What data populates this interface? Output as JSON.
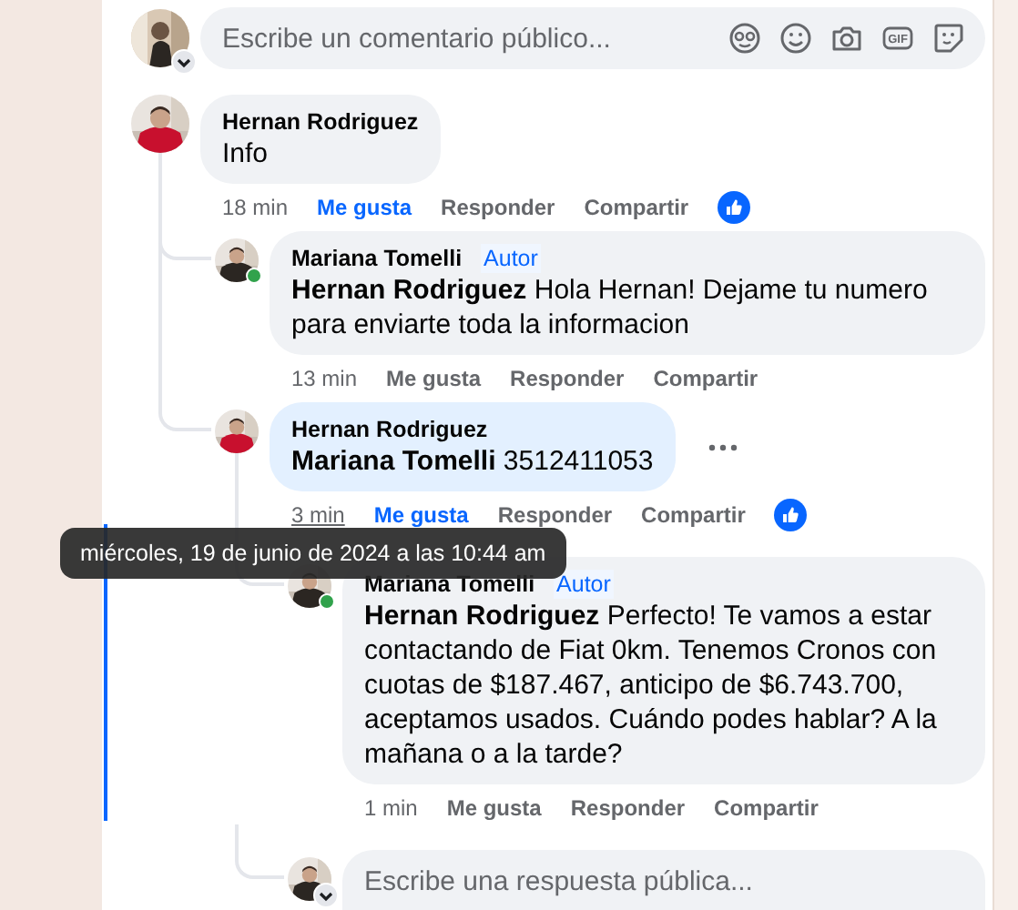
{
  "composer": {
    "placeholder": "Escribe un comentario público...",
    "gif_label": "GIF",
    "avatar": {
      "kind": "picture",
      "color": "#2b2622"
    }
  },
  "comments": [
    {
      "author": "Hernan Rodriguez",
      "text": "Info",
      "avatar": {
        "kind": "picture",
        "color": "#c8102e"
      },
      "highlighted": false,
      "time": "18 min",
      "time_hovered": false,
      "actions": [
        "Me gusta",
        "Responder",
        "Compartir"
      ],
      "liked": true,
      "reaction": true,
      "children": [
        {
          "author": "Mariana Tomelli",
          "badge": "Autor",
          "text": "**Hernan Rodriguez** Hola Hernan! Dejame tu numero para enviarte toda la informacion",
          "avatar": {
            "kind": "picture",
            "color": "#2b2622"
          },
          "online": true,
          "highlighted": false,
          "time": "13 min",
          "time_hovered": false,
          "actions": [
            "Me gusta",
            "Responder",
            "Compartir"
          ],
          "liked": false
        },
        {
          "author": "Hernan Rodriguez",
          "text": "**Mariana Tomelli** 3512411053",
          "avatar": {
            "kind": "picture",
            "color": "#c8102e"
          },
          "highlighted": true,
          "more": true,
          "time": "3 min",
          "time_hovered": true,
          "actions": [
            "Me gusta",
            "Responder",
            "Compartir"
          ],
          "liked": true,
          "reaction": true,
          "children": [
            {
              "author": "Mariana Tomelli",
              "badge": "Autor",
              "text": "**Hernan Rodriguez** Perfecto! Te vamos a estar contactando de Fiat 0km. Tenemos Cronos con cuotas de $187.467, anticipo de $6.743.700, aceptamos usados. Cuándo podes hablar? A la mañana o a la tarde?",
              "avatar": {
                "kind": "picture",
                "color": "#2b2622"
              },
              "online": true,
              "highlighted": false,
              "focused": true,
              "time": "1 min",
              "time_hovered": false,
              "actions": [
                "Me gusta",
                "Responder",
                "Compartir"
              ],
              "liked": false
            }
          ],
          "reply_box": {
            "placeholder": "Escribe una respuesta pública...",
            "avatar": {
              "kind": "picture",
              "color": "#2b2622"
            }
          }
        }
      ]
    }
  ],
  "tooltip": "miércoles, 19 de junio de 2024 a las 10:44 am"
}
